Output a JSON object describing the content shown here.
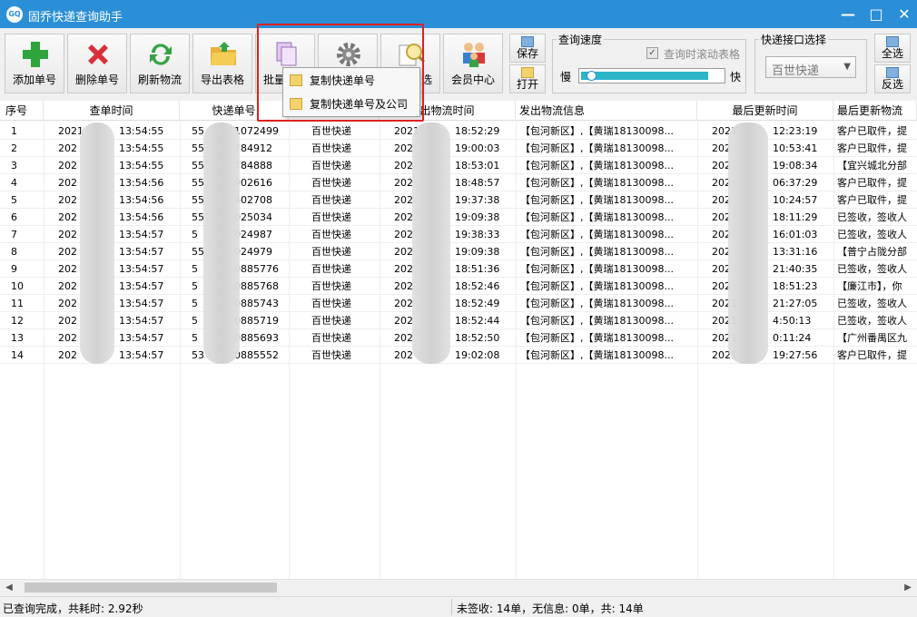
{
  "window": {
    "title": "固乔快递查询助手",
    "icon_text": "GQ",
    "minimize": "—",
    "maximize": "□",
    "close": "✕"
  },
  "toolbar": {
    "add": "添加单号",
    "delete": "删除单号",
    "refresh": "刷新物流",
    "export": "导出表格",
    "batch": "批量",
    "filter_suffix": "选",
    "member": "会员中心",
    "save": "保存",
    "open": "打开"
  },
  "speed": {
    "group_label": "查询速度",
    "slow": "慢",
    "fast": "快",
    "scroll_label": "查询时滚动表格",
    "level": 0.9
  },
  "api": {
    "group_label": "快递接口选择",
    "selected": "百世快递"
  },
  "select_all": "全选",
  "invert": "反选",
  "context_menu": {
    "item1": "复制快递单号",
    "item2": "复制快递单号及公司"
  },
  "table": {
    "headers": [
      "序号",
      "查单时间",
      "快递单号",
      "快递公司",
      "出物流时间",
      "发出物流信息",
      "最后更新时间",
      "最后更新物流"
    ],
    "rows": [
      {
        "no": "1",
        "qdate": "2021",
        "qtime": "13:54:55",
        "num_pre": "55",
        "num_suf": "1072499",
        "co": "百世快递",
        "sdate": "2021",
        "stime": "18:52:29",
        "sinfo": "【包河新区】,【黄瑞18130098...",
        "ldate": "2021",
        "ltime": "12:23:19",
        "linfo": "客户已取件，提"
      },
      {
        "no": "2",
        "qdate": "202",
        "qtime": "13:54:55",
        "num_pre": "55",
        "num_suf": "784912",
        "co": "百世快递",
        "sdate": "202",
        "stime": "19:00:03",
        "sinfo": "【包河新区】,【黄瑞18130098...",
        "ldate": "202",
        "ltime": "10:53:41",
        "linfo": "客户已取件，提"
      },
      {
        "no": "3",
        "qdate": "202",
        "qtime": "13:54:55",
        "num_pre": "55",
        "num_suf": "784888",
        "co": "百世快递",
        "sdate": "202",
        "stime": "18:53:01",
        "sinfo": "【包河新区】,【黄瑞18130098...",
        "ldate": "202",
        "ltime": "19:08:34",
        "linfo": "【宜兴城北分部"
      },
      {
        "no": "4",
        "qdate": "202",
        "qtime": "13:54:56",
        "num_pre": "55",
        "num_suf": "902616",
        "co": "百世快递",
        "sdate": "202",
        "stime": "18:48:57",
        "sinfo": "【包河新区】,【黄瑞18130098...",
        "ldate": "202",
        "ltime": "06:37:29",
        "linfo": "客户已取件，提"
      },
      {
        "no": "5",
        "qdate": "202",
        "qtime": "13:54:56",
        "num_pre": "55",
        "num_suf": "402708",
        "co": "百世快递",
        "sdate": "202",
        "stime": "19:37:38",
        "sinfo": "【包河新区】,【黄瑞18130098...",
        "ldate": "202",
        "ltime": "10:24:57",
        "linfo": "客户已取件，提"
      },
      {
        "no": "6",
        "qdate": "202",
        "qtime": "13:54:56",
        "num_pre": "55",
        "num_suf": "025034",
        "co": "百世快递",
        "sdate": "202",
        "stime": "19:09:38",
        "sinfo": "【包河新区】,【黄瑞18130098...",
        "ldate": "202",
        "ltime": "18:11:29",
        "linfo": "已签收，签收人"
      },
      {
        "no": "7",
        "qdate": "202",
        "qtime": "13:54:57",
        "num_pre": "5",
        "num_suf": "024987",
        "co": "百世快递",
        "sdate": "202",
        "stime": "19:38:33",
        "sinfo": "【包河新区】,【黄瑞18130098...",
        "ldate": "202",
        "ltime": "16:01:03",
        "linfo": "已签收，签收人"
      },
      {
        "no": "8",
        "qdate": "202",
        "qtime": "13:54:57",
        "num_pre": "55",
        "num_suf": "024979",
        "co": "百世快递",
        "sdate": "202",
        "stime": "19:09:38",
        "sinfo": "【包河新区】,【黄瑞18130098...",
        "ldate": "202",
        "ltime": "13:31:16",
        "linfo": "【普宁占陇分部"
      },
      {
        "no": "9",
        "qdate": "202",
        "qtime": "13:54:57",
        "num_pre": "5",
        "num_suf": "0885776",
        "co": "百世快递",
        "sdate": "202",
        "stime": "18:51:36",
        "sinfo": "【包河新区】,【黄瑞18130098...",
        "ldate": "202",
        "ltime": "21:40:35",
        "linfo": "已签收，签收人"
      },
      {
        "no": "10",
        "qdate": "202",
        "qtime": "13:54:57",
        "num_pre": "5",
        "num_suf": "0885768",
        "co": "百世快递",
        "sdate": "202",
        "stime": "18:52:46",
        "sinfo": "【包河新区】,【黄瑞18130098...",
        "ldate": "202",
        "ltime": "18:51:23",
        "linfo": "【廉江市】，你"
      },
      {
        "no": "11",
        "qdate": "202",
        "qtime": "13:54:57",
        "num_pre": "5",
        "num_suf": "0885743",
        "co": "百世快递",
        "sdate": "202",
        "stime": "18:52:49",
        "sinfo": "【包河新区】,【黄瑞18130098...",
        "ldate": "2021",
        "ltime": "21:27:05",
        "linfo": "已签收，签收人"
      },
      {
        "no": "12",
        "qdate": "202",
        "qtime": "13:54:57",
        "num_pre": "5",
        "num_suf": "0885719",
        "co": "百世快递",
        "sdate": "202",
        "stime": "18:52:44",
        "sinfo": "【包河新区】,【黄瑞18130098...",
        "ldate": "2021",
        "ltime": "4:50:13",
        "linfo": "已签收，签收人"
      },
      {
        "no": "13",
        "qdate": "202",
        "qtime": "13:54:57",
        "num_pre": "5",
        "num_suf": "0885693",
        "co": "百世快递",
        "sdate": "202",
        "stime": "18:52:50",
        "sinfo": "【包河新区】,【黄瑞18130098...",
        "ldate": "2021",
        "ltime": "0:11:24",
        "linfo": "【广州番禺区九"
      },
      {
        "no": "14",
        "qdate": "202",
        "qtime": "13:54:57",
        "num_pre": "53",
        "num_suf": "0885552",
        "co": "百世快递",
        "sdate": "202",
        "stime": "19:02:08",
        "sinfo": "【包河新区】,【黄瑞18130098...",
        "ldate": "2021",
        "ltime": "19:27:56",
        "linfo": "客户已取件，提"
      }
    ]
  },
  "status": {
    "left": "已查询完成，共耗时: 2.92秒",
    "right": "未签收: 14单，无信息: 0单，共: 14单"
  },
  "icons": {
    "add": "plus-icon",
    "delete": "x-icon",
    "refresh": "refresh-icon",
    "export": "folder-icon",
    "batch": "copy-icon",
    "settings": "gear-icon",
    "filter": "magnifier-icon",
    "member": "people-icon"
  },
  "colors": {
    "titlebar": "#2b8fd8",
    "speed_fill": "#2bb5c9",
    "highlight": "#e02020"
  }
}
